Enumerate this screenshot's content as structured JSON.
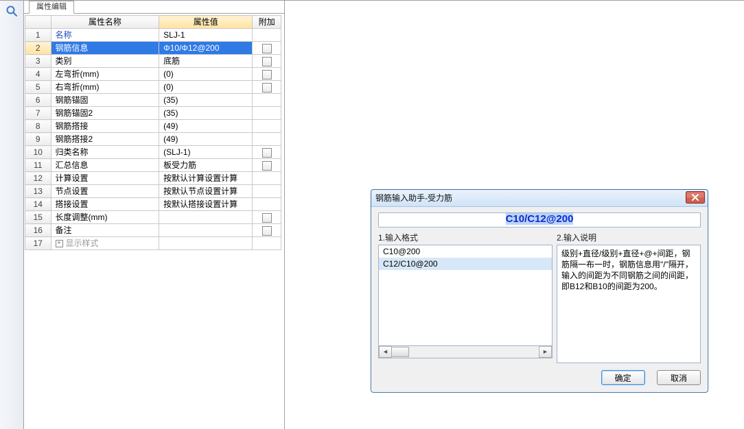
{
  "panel": {
    "tab_label": "属性编辑",
    "search_icon_name": "search-icon",
    "columns": {
      "name": "属性名称",
      "value": "属性值",
      "extra": "附加"
    },
    "rows": [
      {
        "n": "1",
        "name": "名称",
        "val": "SLJ-1",
        "link": true,
        "chk": false
      },
      {
        "n": "2",
        "name": "钢筋信息",
        "val": "Φ10/Φ12@200",
        "sel": true,
        "chk": true
      },
      {
        "n": "3",
        "name": "类别",
        "val": "底筋",
        "chk": true
      },
      {
        "n": "4",
        "name": "左弯折(mm)",
        "val": "(0)",
        "chk": true
      },
      {
        "n": "5",
        "name": "右弯折(mm)",
        "val": "(0)",
        "chk": true
      },
      {
        "n": "6",
        "name": "钢筋锚固",
        "val": "(35)",
        "chk": false
      },
      {
        "n": "7",
        "name": "钢筋锚固2",
        "val": "(35)",
        "chk": false
      },
      {
        "n": "8",
        "name": "钢筋搭接",
        "val": "(49)",
        "chk": false
      },
      {
        "n": "9",
        "name": "钢筋搭接2",
        "val": "(49)",
        "chk": false
      },
      {
        "n": "10",
        "name": "归类名称",
        "val": "(SLJ-1)",
        "chk": true
      },
      {
        "n": "11",
        "name": "汇总信息",
        "val": "板受力筋",
        "chk": true
      },
      {
        "n": "12",
        "name": "计算设置",
        "val": "按默认计算设置计算",
        "chk": false
      },
      {
        "n": "13",
        "name": "节点设置",
        "val": "按默认节点设置计算",
        "chk": false
      },
      {
        "n": "14",
        "name": "搭接设置",
        "val": "按默认搭接设置计算",
        "chk": false
      },
      {
        "n": "15",
        "name": "长度调整(mm)",
        "val": "",
        "chk": true
      },
      {
        "n": "16",
        "name": "备注",
        "val": "",
        "chk": true
      },
      {
        "n": "17",
        "name": "显示样式",
        "val": "",
        "expand": true,
        "muted": true,
        "chk": false
      }
    ]
  },
  "dialog": {
    "title": "钢筋输入助手-受力筋",
    "input_value": "C10/C12@200",
    "left_title": "1.输入格式",
    "right_title": "2.输入说明",
    "formats": [
      {
        "text": "C10@200",
        "sel": false
      },
      {
        "text": "C12/C10@200",
        "sel": true
      }
    ],
    "description": "级别+直径/级别+直径+@+间距，钢筋隔一布一时，钢筋信息用\"/\"隔开，输入的间距为不同钢筋之间的间距，即B12和B10的间距为200。",
    "ok": "确定",
    "cancel": "取消"
  }
}
